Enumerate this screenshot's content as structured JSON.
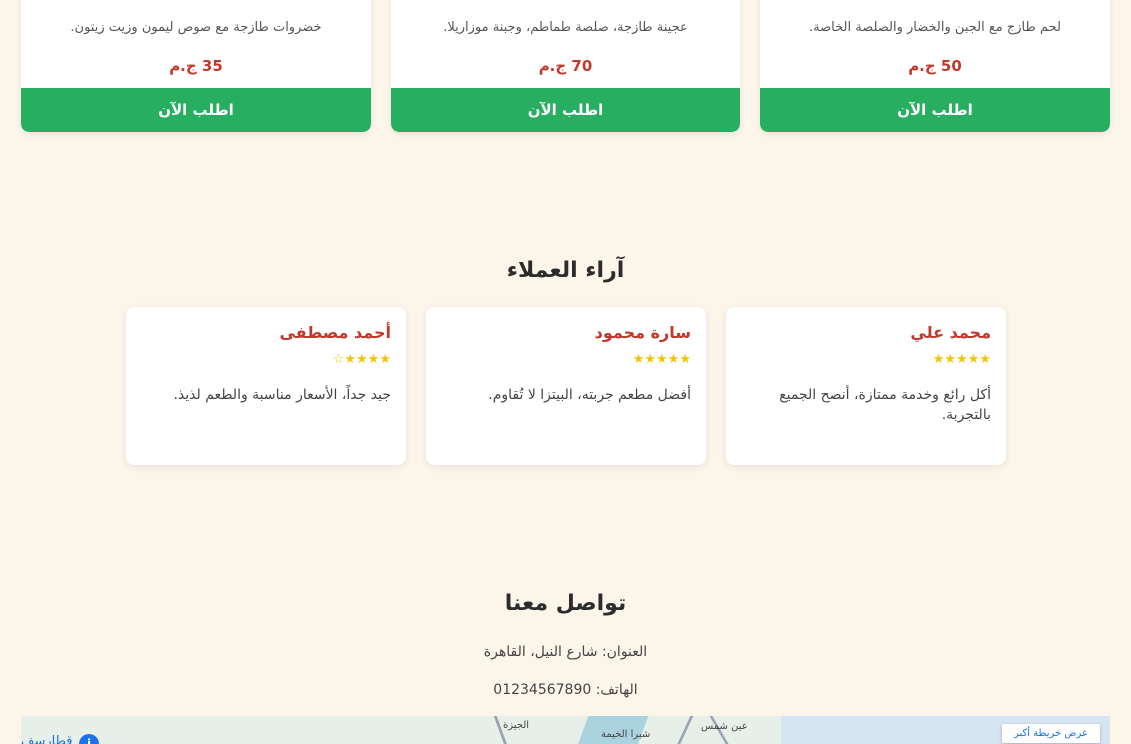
{
  "menu": {
    "items": [
      {
        "description": "لحم طازج مع الجبن والخضار والصلصة الخاصة.",
        "price": "50 ج.م",
        "order_label": "اطلب الآن"
      },
      {
        "description": "عجينة طازجة، صلصة طماطم، وجبنة موزاريلا.",
        "price": "70 ج.م",
        "order_label": "اطلب الآن"
      },
      {
        "description": "خضروات طازجة مع صوص ليمون وزيت زيتون.",
        "price": "35 ج.م",
        "order_label": "اطلب الآن"
      }
    ]
  },
  "reviews": {
    "title": "آراء العملاء",
    "items": [
      {
        "name": "محمد علي",
        "stars": "★★★★★",
        "rating": 5,
        "text": "أكل رائع وخدمة ممتازة، أنصح الجميع بالتجربة."
      },
      {
        "name": "سارة محمود",
        "stars": "★★★★★",
        "rating": 5,
        "text": "أفضل مطعم جربته، البيتزا لا تُقاوم."
      },
      {
        "name": "أحمد مصطفى",
        "stars": "★★★★☆",
        "rating": 4,
        "text": "جيد جداً، الأسعار مناسبة والطعم لذيذ."
      }
    ]
  },
  "contact": {
    "title": "تواصل معنا",
    "address": "العنوان: شارع النيل، القاهرة",
    "phone": "الهاتف: 01234567890"
  },
  "map": {
    "labels": {
      "ain_shams": "عين شمس",
      "shubra": "شبرا الخيمة",
      "giza": "الجيزة",
      "view_larger": "عرض خريطة أكبر",
      "place": "قطارسف"
    },
    "colors": {
      "land": "#e6efe8",
      "water": "#aad3df",
      "link": "#1a73e8"
    }
  },
  "colors": {
    "background": "#fcf5ea",
    "accent_green": "#27ae60",
    "accent_red": "#c0392b",
    "star": "#f1c40f"
  }
}
